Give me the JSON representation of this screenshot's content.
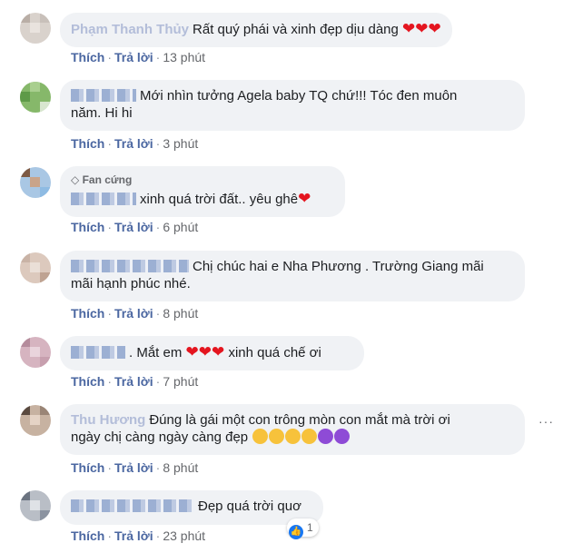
{
  "comments": [
    {
      "name": "Phạm Thanh Thủy",
      "text": "Rất quý phái và xinh đẹp dịu dàng",
      "reactions_inline": [
        "heart",
        "heart",
        "heart"
      ],
      "actions": {
        "like": "Thích",
        "reply": "Trả lời",
        "time": "13 phút"
      }
    },
    {
      "text_line1": "Mới nhìn tưởng Agela baby TQ chứ!!! Tóc đen muôn",
      "text_line2": "năm. Hi hi",
      "actions": {
        "like": "Thích",
        "reply": "Trả lời",
        "time": "3 phút"
      }
    },
    {
      "badge": "Fan cứng",
      "text": "xinh quá trời đất.. yêu ghê",
      "actions": {
        "like": "Thích",
        "reply": "Trả lời",
        "time": "6 phút"
      }
    },
    {
      "text_line1": "Chị chúc hai e Nha Phương . Trường Giang mãi",
      "text_line2": "mãi hạnh phúc nhé.",
      "actions": {
        "like": "Thích",
        "reply": "Trả lời",
        "time": "8 phút"
      }
    },
    {
      "text_a": ". Mắt em",
      "text_b": "xinh quá chế ơi",
      "actions": {
        "like": "Thích",
        "reply": "Trả lời",
        "time": "7 phút"
      }
    },
    {
      "name": "Thu Hương",
      "text_line1": "Đúng là gái một con trông mòn con mắt mà trời ơi",
      "text_line2": "ngày chị càng ngày càng đẹp",
      "actions": {
        "like": "Thích",
        "reply": "Trả lời",
        "time": "8 phút"
      },
      "more": "···"
    },
    {
      "text": "Đẹp quá trời quơ",
      "actions": {
        "like": "Thích",
        "reply": "Trả lời",
        "time": "23 phút"
      },
      "reaction_count": "1"
    }
  ],
  "colors": {
    "link": "#4b67a1",
    "bubble": "#f0f2f5",
    "heart": "#e4151f",
    "like": "#1877f2"
  }
}
